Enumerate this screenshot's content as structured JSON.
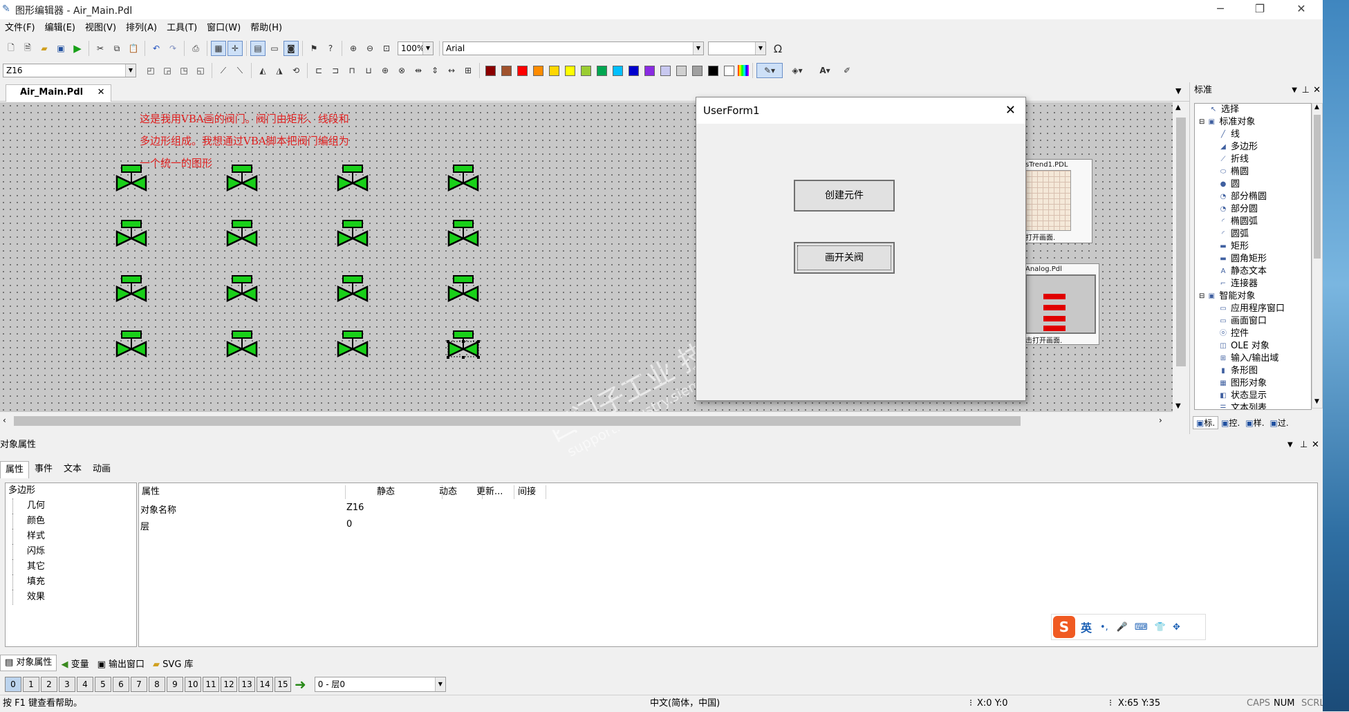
{
  "window": {
    "title": "图形编辑器 - Air_Main.Pdl"
  },
  "menu": [
    "文件(F)",
    "编辑(E)",
    "视图(V)",
    "排列(A)",
    "工具(T)",
    "窗口(W)",
    "帮助(H)"
  ],
  "toolbar": {
    "zoom": "100%",
    "font": "Arial",
    "font_size": "",
    "omega": "Ω"
  },
  "toolbar2": {
    "object_name": "Z16"
  },
  "palette": [
    "#8b0000",
    "#a0522d",
    "#ff0000",
    "#ff8c00",
    "#ffd700",
    "#ffff00",
    "#9acd32",
    "#00a651",
    "#00bfff",
    "#0000cd",
    "#8a2be2",
    "#c8c8f0",
    "#d0d0d0",
    "#a0a0a0",
    "#000000",
    "#ffffff"
  ],
  "document": {
    "tab": "Air_Main.Pdl"
  },
  "canvas": {
    "note_line1": "这是我用VBA画的阀门。阀门由矩形、线段和",
    "note_line2": "多边形组成。我想通过VBA脚本把阀门编组为",
    "note_line3": "一个统一的图形",
    "thumb1_title": "sTrend1.PDL",
    "thumb1_caption": "打开画面.",
    "thumb2_title": "Analog.Pdl",
    "thumb2_caption": "击打开画面.",
    "watermark": "西门子工业 技术论坛 support.industry.siemens.com/cs"
  },
  "userform": {
    "title": "UserForm1",
    "btn1": "创建元件",
    "btn2": "画开关阀"
  },
  "right_panel": {
    "title": "标准",
    "items": [
      {
        "label": "选择",
        "indent": 1,
        "icon": "cursor"
      },
      {
        "label": "标准对象",
        "indent": 0,
        "icon": "folder"
      },
      {
        "label": "线",
        "indent": 2,
        "icon": "line"
      },
      {
        "label": "多边形",
        "indent": 2,
        "icon": "polygon"
      },
      {
        "label": "折线",
        "indent": 2,
        "icon": "polyline"
      },
      {
        "label": "椭圆",
        "indent": 2,
        "icon": "ellipse"
      },
      {
        "label": "圆",
        "indent": 2,
        "icon": "circle"
      },
      {
        "label": "部分椭圆",
        "indent": 2,
        "icon": "pie"
      },
      {
        "label": "部分圆",
        "indent": 2,
        "icon": "pie"
      },
      {
        "label": "椭圆弧",
        "indent": 2,
        "icon": "arc"
      },
      {
        "label": "圆弧",
        "indent": 2,
        "icon": "arc"
      },
      {
        "label": "矩形",
        "indent": 2,
        "icon": "rect"
      },
      {
        "label": "圆角矩形",
        "indent": 2,
        "icon": "rect"
      },
      {
        "label": "静态文本",
        "indent": 2,
        "icon": "text"
      },
      {
        "label": "连接器",
        "indent": 2,
        "icon": "connector"
      },
      {
        "label": "智能对象",
        "indent": 0,
        "icon": "folder"
      },
      {
        "label": "应用程序窗口",
        "indent": 2,
        "icon": "window"
      },
      {
        "label": "画面窗口",
        "indent": 2,
        "icon": "window"
      },
      {
        "label": "控件",
        "indent": 2,
        "icon": "ocx"
      },
      {
        "label": "OLE 对象",
        "indent": 2,
        "icon": "ole"
      },
      {
        "label": "输入/输出域",
        "indent": 2,
        "icon": "io"
      },
      {
        "label": "条形图",
        "indent": 2,
        "icon": "bar"
      },
      {
        "label": "图形对象",
        "indent": 2,
        "icon": "graphic"
      },
      {
        "label": "状态显示",
        "indent": 2,
        "icon": "status"
      },
      {
        "label": "文本列表",
        "indent": 2,
        "icon": "list"
      }
    ],
    "bottom_tabs": [
      "标.",
      "控.",
      "样.",
      "过."
    ]
  },
  "props": {
    "title": "对象属性",
    "tabs": [
      "属性",
      "事件",
      "文本",
      "动画"
    ],
    "tree": [
      "多边形",
      "几何",
      "颜色",
      "样式",
      "闪烁",
      "其它",
      "填充",
      "效果"
    ],
    "columns": [
      "属性",
      "静态",
      "动态",
      "更新...",
      "间接"
    ],
    "rows": [
      {
        "name": "对象名称",
        "value": "Z16"
      },
      {
        "name": "层",
        "value": "0"
      }
    ]
  },
  "bottom_tabs": [
    "对象属性",
    "变量",
    "输出窗口",
    "SVG 库"
  ],
  "layers": {
    "buttons": [
      "0",
      "1",
      "2",
      "3",
      "4",
      "5",
      "6",
      "7",
      "8",
      "9",
      "10",
      "11",
      "12",
      "13",
      "14",
      "15"
    ],
    "current": "0 - 层0"
  },
  "status": {
    "help": "按 F1 键查看帮助。",
    "locale": "中文(简体，中国)",
    "pos": "X:0 Y:0",
    "size": "X:65 Y:35",
    "caps": "CAPS",
    "num": "NUM",
    "scrl": "SCRL"
  },
  "ime": {
    "lang": "英"
  }
}
